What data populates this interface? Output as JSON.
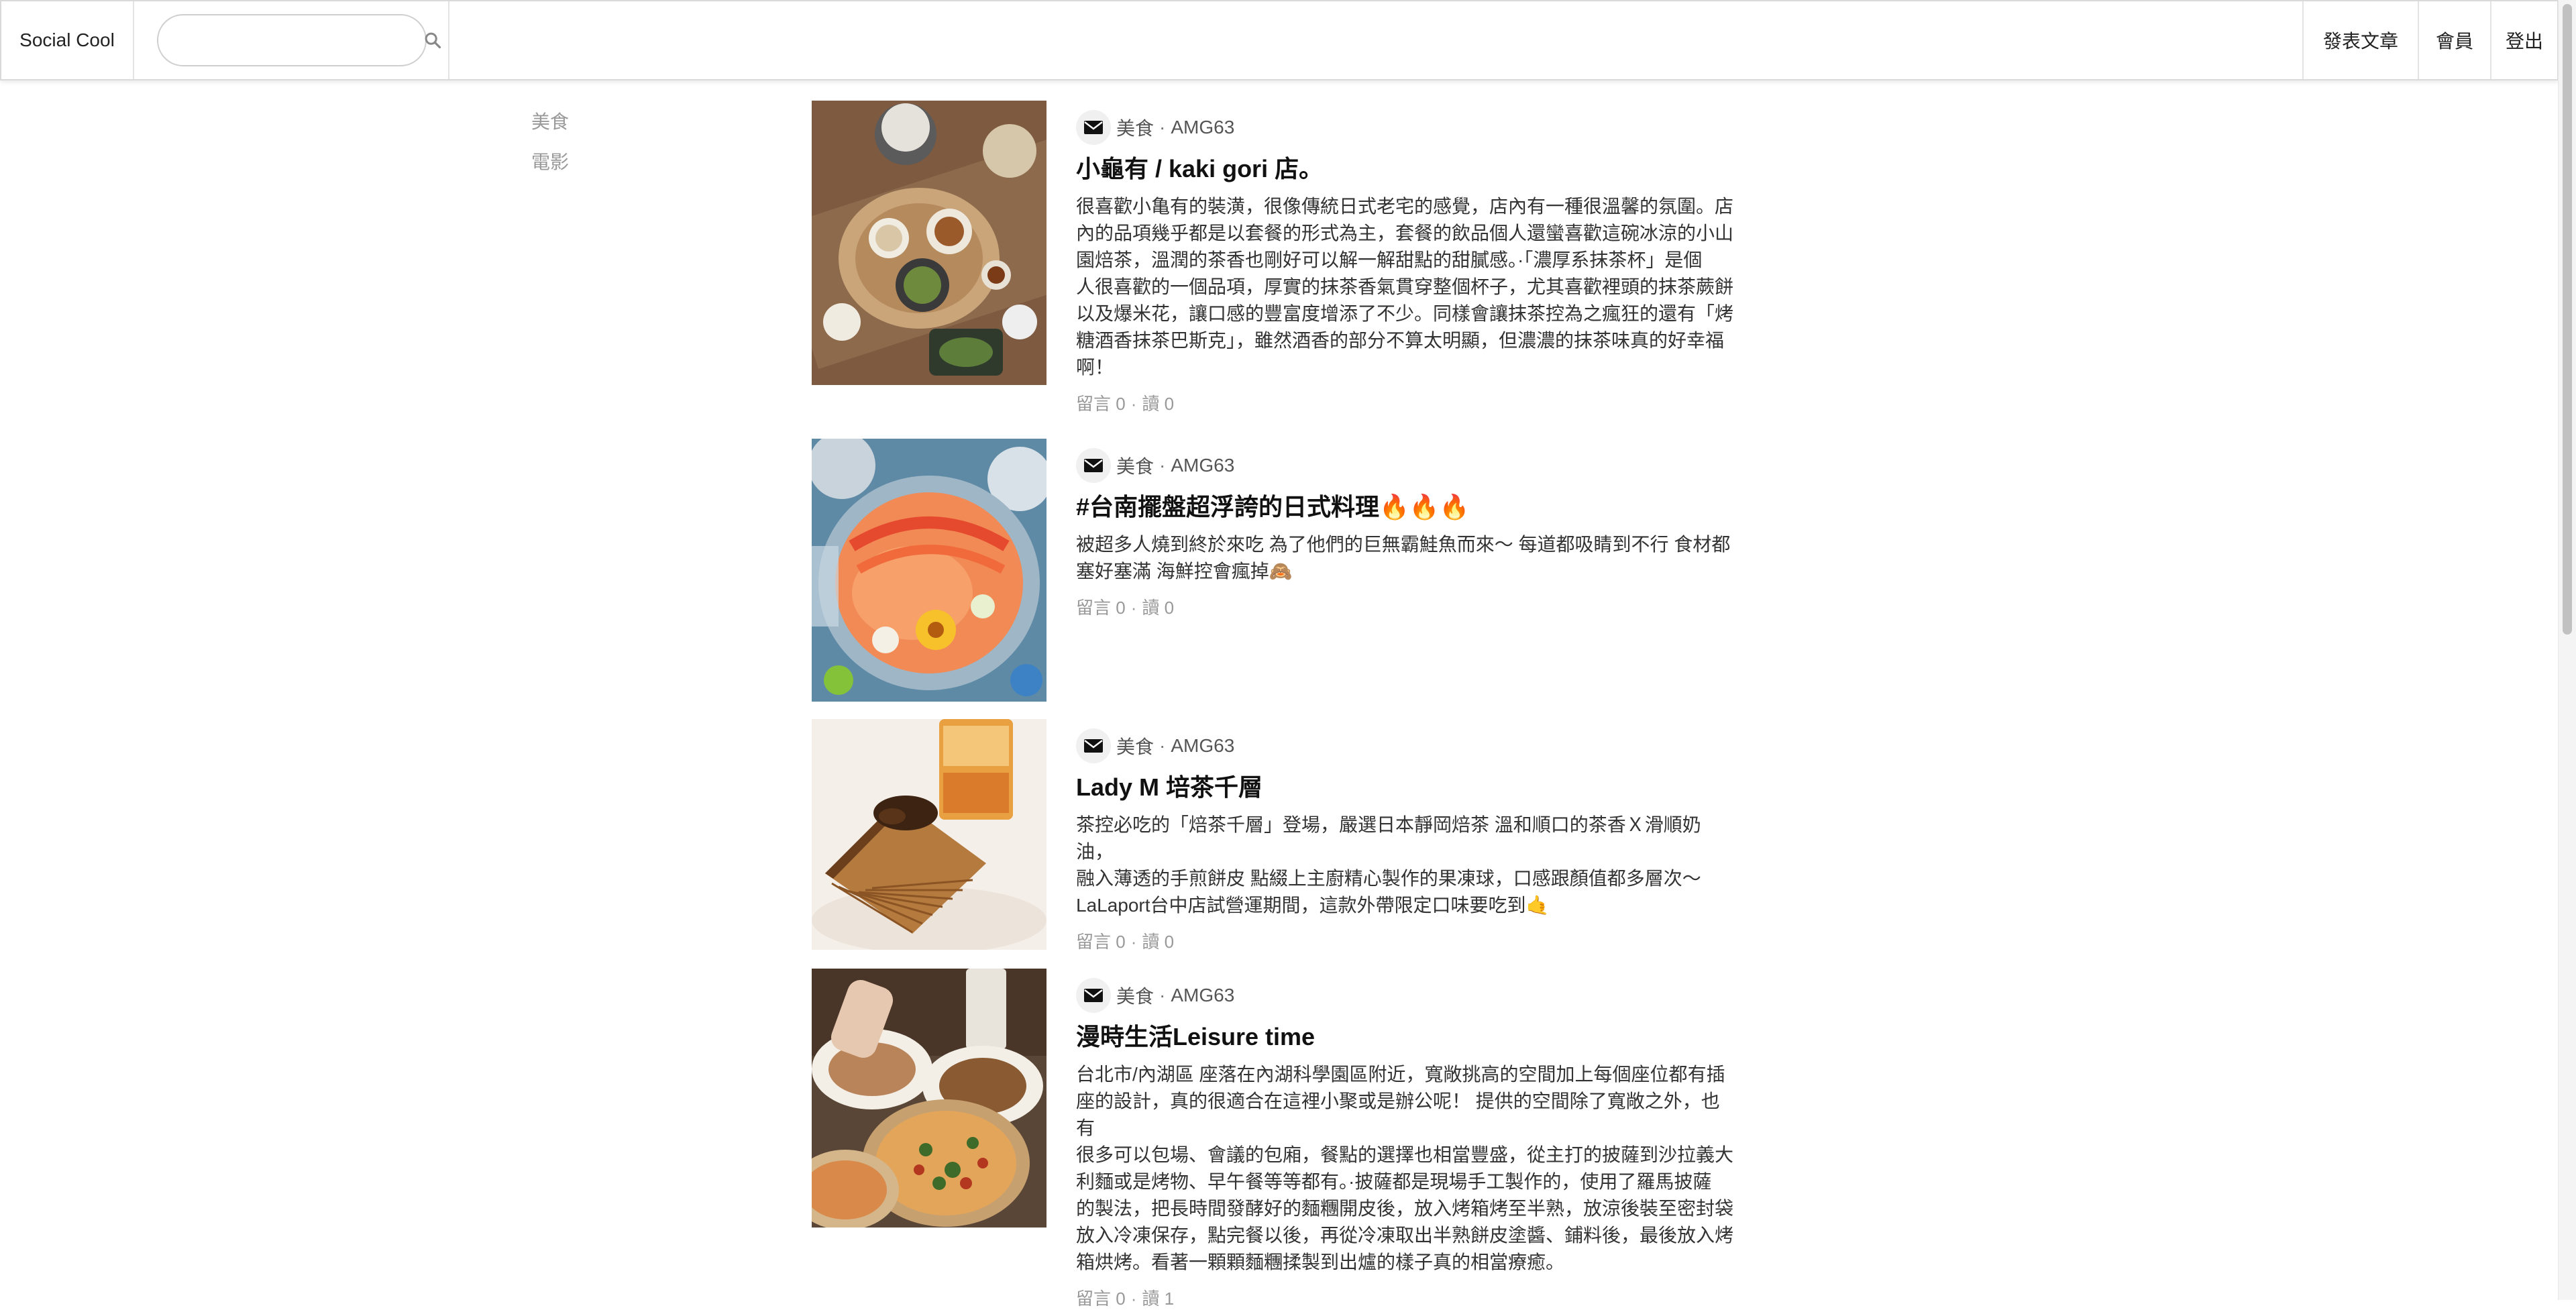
{
  "nav": {
    "brand": "Social Cool",
    "search_placeholder": "",
    "search_value": "",
    "links": [
      "發表文章",
      "會員",
      "登出"
    ]
  },
  "categories": [
    "美食",
    "電影"
  ],
  "posts": [
    {
      "category": "美食",
      "author": "AMG63",
      "title": "小龜有 / kaki gori 店。",
      "excerpt": "很喜歡小亀有的裝潢，很像傳統日式老宅的感覺，店內有一種很溫馨的氛圍。店\n內的品項幾乎都是以套餐的形式為主，套餐的飲品個人還蠻喜歡這碗冰涼的小山\n園焙茶，溫潤的茶香也剛好可以解一解甜點的甜膩感。·「濃厚系抹茶杯」是個\n人很喜歡的一個品項，厚實的抹茶香氣貫穿整個杯子，尤其喜歡裡頭的抹茶蕨餅\n以及爆米花，讓口感的豐富度增添了不少。同樣會讓抹茶控為之瘋狂的還有「烤\n糖酒香抹茶巴斯克」，雖然酒香的部分不算太明顯，但濃濃的抹茶味真的好幸福\n啊！",
      "comments_label": "留言 0",
      "reads_label": "讀 0",
      "image": "matcha-dessert-set"
    },
    {
      "category": "美食",
      "author": "AMG63",
      "title": "#台南擺盤超浮誇的日式料理🔥🔥🔥",
      "excerpt": "被超多人燒到終於來吃 為了他們的巨無霸鮭魚而來～ 每道都吸睛到不行 食材都\n塞好塞滿 海鮮控會瘋掉🙈",
      "comments_label": "留言 0",
      "reads_label": "讀 0",
      "image": "seafood-platter"
    },
    {
      "category": "美食",
      "author": "AMG63",
      "title": "Lady M 培茶千層",
      "excerpt": "茶控必吃的「焙茶千層」登場，嚴選日本靜岡焙茶 溫和順口的茶香Ｘ滑順奶油，\n融入薄透的手煎餅皮 點綴上主廚精心製作的果凍球，口感跟顏值都多層次～\nLaLaport台中店試營運期間，這款外帶限定口味要吃到🤙",
      "comments_label": "留言 0",
      "reads_label": "讀 0",
      "image": "mille-crepe-cake"
    },
    {
      "category": "美食",
      "author": "AMG63",
      "title": "漫時生活Leisure time",
      "excerpt": "台北市/內湖區 座落在內湖科學園區附近，寬敞挑高的空間加上每個座位都有插\n座的設計，真的很適合在這裡小聚或是辦公呢！ 提供的空間除了寬敞之外，也有\n很多可以包場、會議的包廂，餐點的選擇也相當豐盛，從主打的披薩到沙拉義大\n利麵或是烤物、早午餐等等都有。·披薩都是現場手工製作的，使用了羅馬披薩\n的製法，把長時間發酵好的麵糰開皮後，放入烤箱烤至半熟，放涼後裝至密封袋\n放入冷凍保存，點完餐以後，再從冷凍取出半熟餅皮塗醬、鋪料後，最後放入烤\n箱烘烤。看著一顆顆麵糰揉製到出爐的樣子真的相當療癒。",
      "comments_label": "留言 0",
      "reads_label": "讀 1",
      "image": "pizza-table"
    }
  ]
}
